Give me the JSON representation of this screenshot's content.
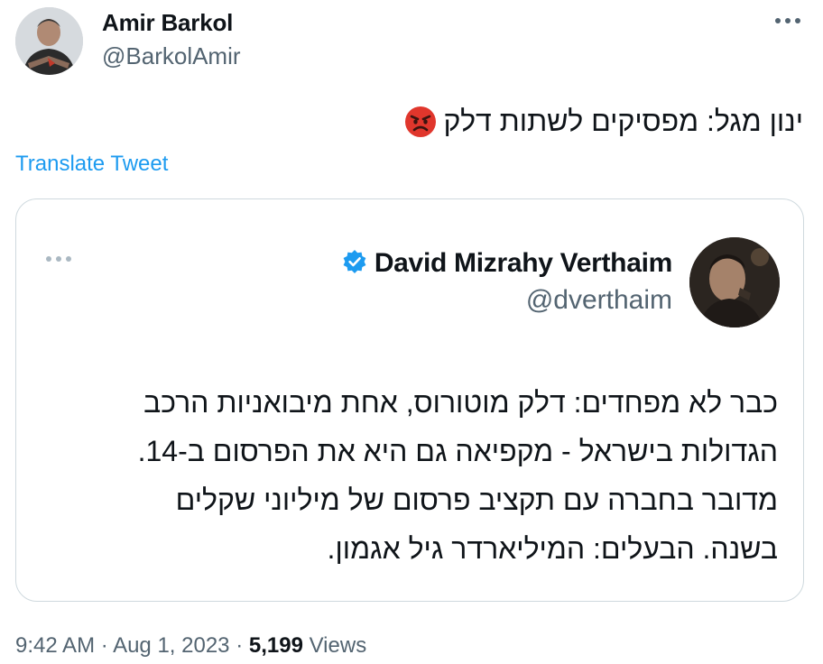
{
  "tweet": {
    "author": {
      "name": "Amir Barkol",
      "handle": "@BarkolAmir"
    },
    "text": "ינון מגל: מפסיקים לשתות דלק",
    "emoji": "angry-face",
    "translate_label": "Translate Tweet",
    "timestamp": {
      "time": "9:42 AM",
      "separator1": "·",
      "date": "Aug 1, 2023",
      "separator2": "·",
      "views_count": "5,199",
      "views_label": "Views"
    }
  },
  "quoted_tweet": {
    "author": {
      "name": "David Mizrahy Verthaim",
      "handle": "@dverthaim",
      "verified": true
    },
    "lines": [
      "כבר לא מפחדים: דלק מוטורוס, אחת מיבואניות הרכב",
      "הגדולות בישראל - מקפיאה גם היא את הפרסום ב-14.",
      "מדובר בחברה עם תקציב פרסום של מיליוני שקלים",
      "בשנה. הבעלים: המיליארדר גיל אגמון."
    ]
  },
  "colors": {
    "link": "#1d9bf0",
    "secondary_text": "#536471",
    "primary_text": "#0f1419",
    "border": "#cfd9de",
    "verified_badge": "#1d9bf0",
    "emoji_face": "#e0362c"
  }
}
